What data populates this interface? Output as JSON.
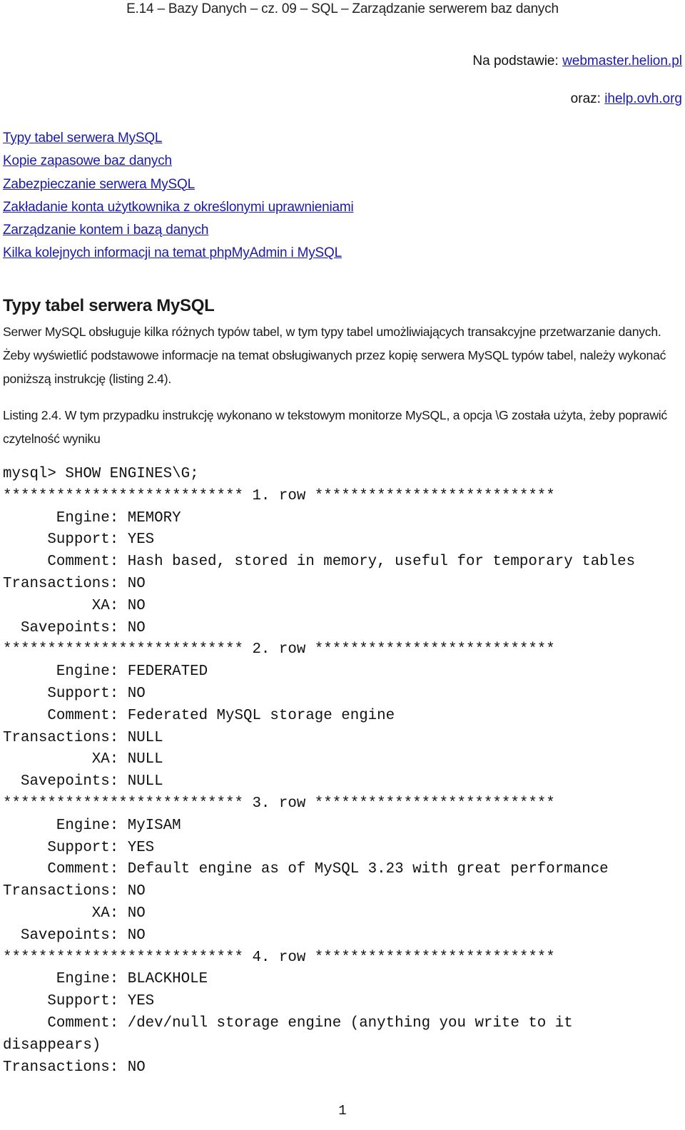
{
  "header": {
    "title": "E.14 – Bazy Danych – cz. 09 – SQL – Zarządzanie serwerem baz danych"
  },
  "sources": [
    {
      "prefix": "Na podstawie: ",
      "link": "webmaster.helion.pl"
    },
    {
      "prefix": "oraz: ",
      "link": "ihelp.ovh.org"
    }
  ],
  "toc": [
    "Typy tabel serwera MySQL",
    "Kopie zapasowe baz danych",
    "Zabezpieczanie serwera MySQL",
    "Zakładanie konta użytkownika z określonymi uprawnieniami",
    "Zarządzanie kontem i bazą danych",
    "Kilka kolejnych informacji na temat phpMyAdmin i MySQL"
  ],
  "section": {
    "title": "Typy tabel serwera MySQL",
    "paragraph": "Serwer MySQL obsługuje kilka różnych typów tabel, w tym typy tabel umożliwiających transakcyjne przetwarzanie danych. Żeby wyświetlić podstawowe informacje na temat obsługiwanych przez kopię serwera MySQL typów tabel, należy wykonać poniższą instrukcję (listing 2.4).",
    "listing_caption": "Listing 2.4. W tym przypadku instrukcję wykonano w tekstowym monitorze MySQL, a opcja \\G została użyta, żeby poprawić czytelność wyniku"
  },
  "listing": {
    "lines": [
      "mysql> SHOW ENGINES\\G;",
      "*************************** 1. row ***************************",
      "      Engine: MEMORY",
      "     Support: YES",
      "     Comment: Hash based, stored in memory, useful for temporary tables",
      "Transactions: NO",
      "          XA: NO",
      "  Savepoints: NO",
      "*************************** 2. row ***************************",
      "      Engine: FEDERATED",
      "     Support: NO",
      "     Comment: Federated MySQL storage engine",
      "Transactions: NULL",
      "          XA: NULL",
      "  Savepoints: NULL",
      "*************************** 3. row ***************************",
      "      Engine: MyISAM",
      "     Support: YES",
      "     Comment: Default engine as of MySQL 3.23 with great performance",
      "Transactions: NO",
      "          XA: NO",
      "  Savepoints: NO",
      "*************************** 4. row ***************************",
      "      Engine: BLACKHOLE",
      "     Support: YES",
      "     Comment: /dev/null storage engine (anything you write to it",
      "disappears)",
      "Transactions: NO"
    ]
  },
  "footer": {
    "page_number": "1"
  }
}
